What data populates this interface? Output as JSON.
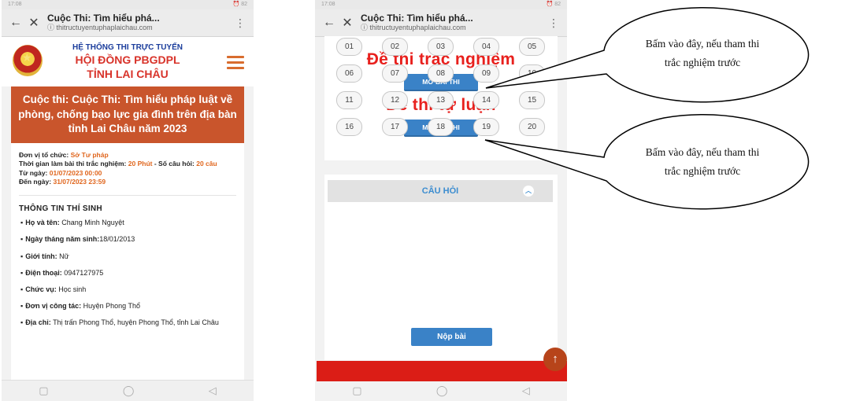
{
  "status_bar": {
    "left_time": "17:08",
    "left_icons": "📶 ✉",
    "right_icons": "⏰ 82"
  },
  "browser": {
    "title": "Cuộc Thi: Tìm hiểu phá...",
    "url": "thitructuyentuphaplaichau.com",
    "back_icon": "arrow-left-icon",
    "close_icon": "close-icon",
    "menu_icon": "more-vertical-icon"
  },
  "left_screen": {
    "header": {
      "line1": "HỆ THỐNG THI TRỰC TUYẾN",
      "line2": "HỘI ĐỒNG PBGDPL",
      "line3": "TỈNH LAI CHÂU"
    },
    "contest_title": "Cuộc thi: Cuộc Thi: Tìm hiểu pháp luật về phòng, chống bạo lực gia đình trên địa bàn tỉnh Lai Châu năm 2023",
    "info": {
      "org_label": "Đơn vị tổ chức:",
      "org_value": "Sở Tư pháp",
      "time_label": "Thời gian làm bài thi trắc nghiệm:",
      "time_value": "20 Phút",
      "count_label": "- Số câu hỏi:",
      "count_value": "20 câu",
      "from_label": "Từ ngày:",
      "from_value": "01/07/2023 00:00",
      "to_label": "Đến ngày:",
      "to_value": "31/07/2023 23:59"
    },
    "candidate": {
      "title": "THÔNG TIN THÍ SINH",
      "rows": [
        {
          "label": "Họ và tên:",
          "value": "Chang Minh Nguyệt"
        },
        {
          "label": "Ngày tháng năm sinh:",
          "value": "18/01/2013"
        },
        {
          "label": "Giới tính:",
          "value": "Nữ"
        },
        {
          "label": "Điện thoại:",
          "value": "0947127975"
        },
        {
          "label": "Chức vụ:",
          "value": "Học sinh"
        },
        {
          "label": "Đơn vị công tác:",
          "value": "Huyện Phong Thổ"
        },
        {
          "label": "Địa chỉ:",
          "value": "Thị trấn Phong Thổ, huyện Phong Thổ, tỉnh Lai Châu"
        }
      ]
    }
  },
  "right_screen": {
    "mc_title": "Đề thi trắc nghiệm",
    "open_btn_1": "MỞ BÀI THI",
    "essay_title": "Đề thi tự luận",
    "open_btn_2": "MỞ BÀI THI",
    "questions_title": "CÂU HỎI",
    "questions": [
      "01",
      "02",
      "03",
      "04",
      "05",
      "06",
      "07",
      "08",
      "09",
      "10",
      "11",
      "12",
      "13",
      "14",
      "15",
      "16",
      "17",
      "18",
      "19",
      "20"
    ],
    "submit": "Nộp bài"
  },
  "callouts": {
    "top": "Bấm vào đây, nếu tham thi trắc nghiệm trước",
    "bottom": "Bấm vào đây, nếu tham thi trắc nghiệm trước"
  },
  "colors": {
    "accent_red": "#e8201d",
    "header_orange": "#c9552c",
    "button_blue": "#3a82c7",
    "label_orange": "#e0661d"
  }
}
